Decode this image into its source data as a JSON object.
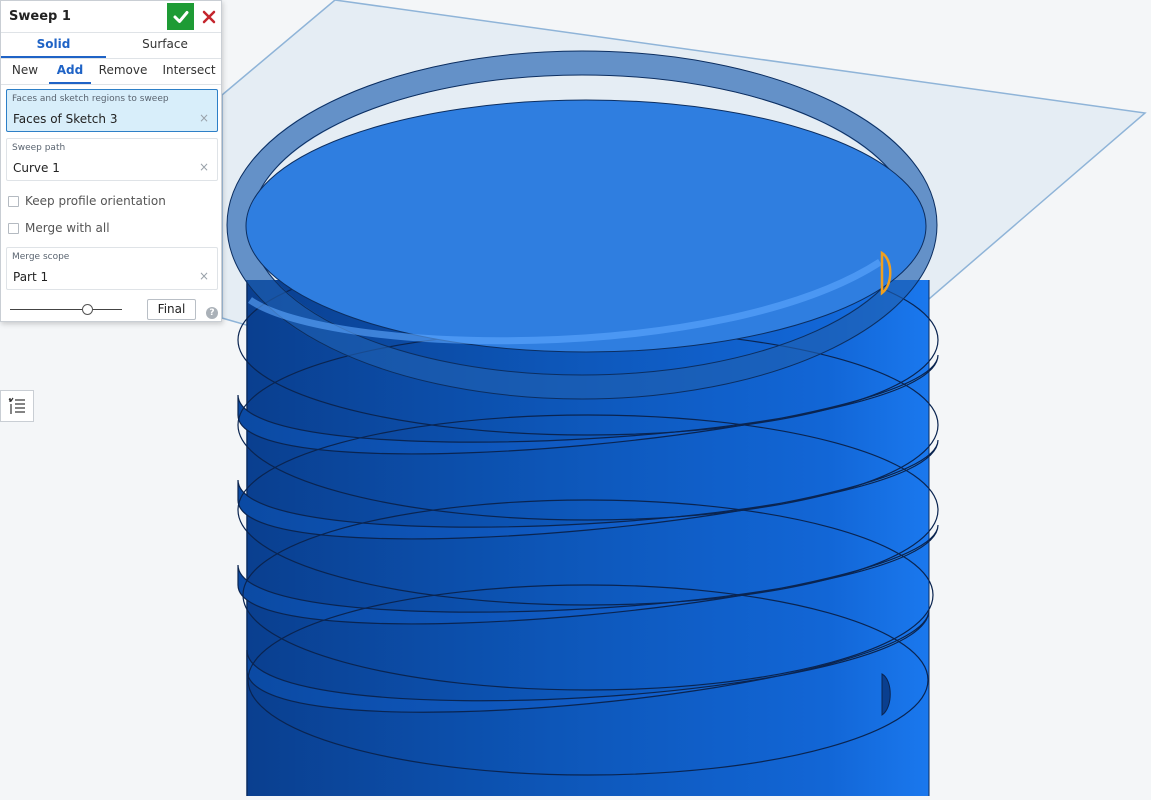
{
  "panel": {
    "title": "Sweep 1",
    "accept_icon": "checkmark-icon",
    "cancel_icon": "close-icon",
    "tabs": [
      "Solid",
      "Surface"
    ],
    "active_tab": "Solid",
    "operations": [
      "New",
      "Add",
      "Remove",
      "Intersect"
    ],
    "active_operation": "Add",
    "faces_field": {
      "label": "Faces and sketch regions to sweep",
      "value": "Faces of Sketch 3"
    },
    "path_field": {
      "label": "Sweep path",
      "value": "Curve 1"
    },
    "keep_orientation_label": "Keep profile orientation",
    "keep_orientation_checked": false,
    "merge_all_label": "Merge with all",
    "merge_all_checked": false,
    "merge_scope_field": {
      "label": "Merge scope",
      "value": "Part 1"
    },
    "slider_position": 0.69,
    "final_label": "Final",
    "help_icon": "help-icon",
    "clear_glyph": "×",
    "help_glyph": "?"
  },
  "sidebar_toggle_icon": "feature-list-icon",
  "colors": {
    "accept_green": "#1e9b35",
    "cancel_red": "#c4252d",
    "accent_blue": "#1f63c6",
    "part_blue": "#0d56b8",
    "highlight_orange": "#f0a020"
  }
}
